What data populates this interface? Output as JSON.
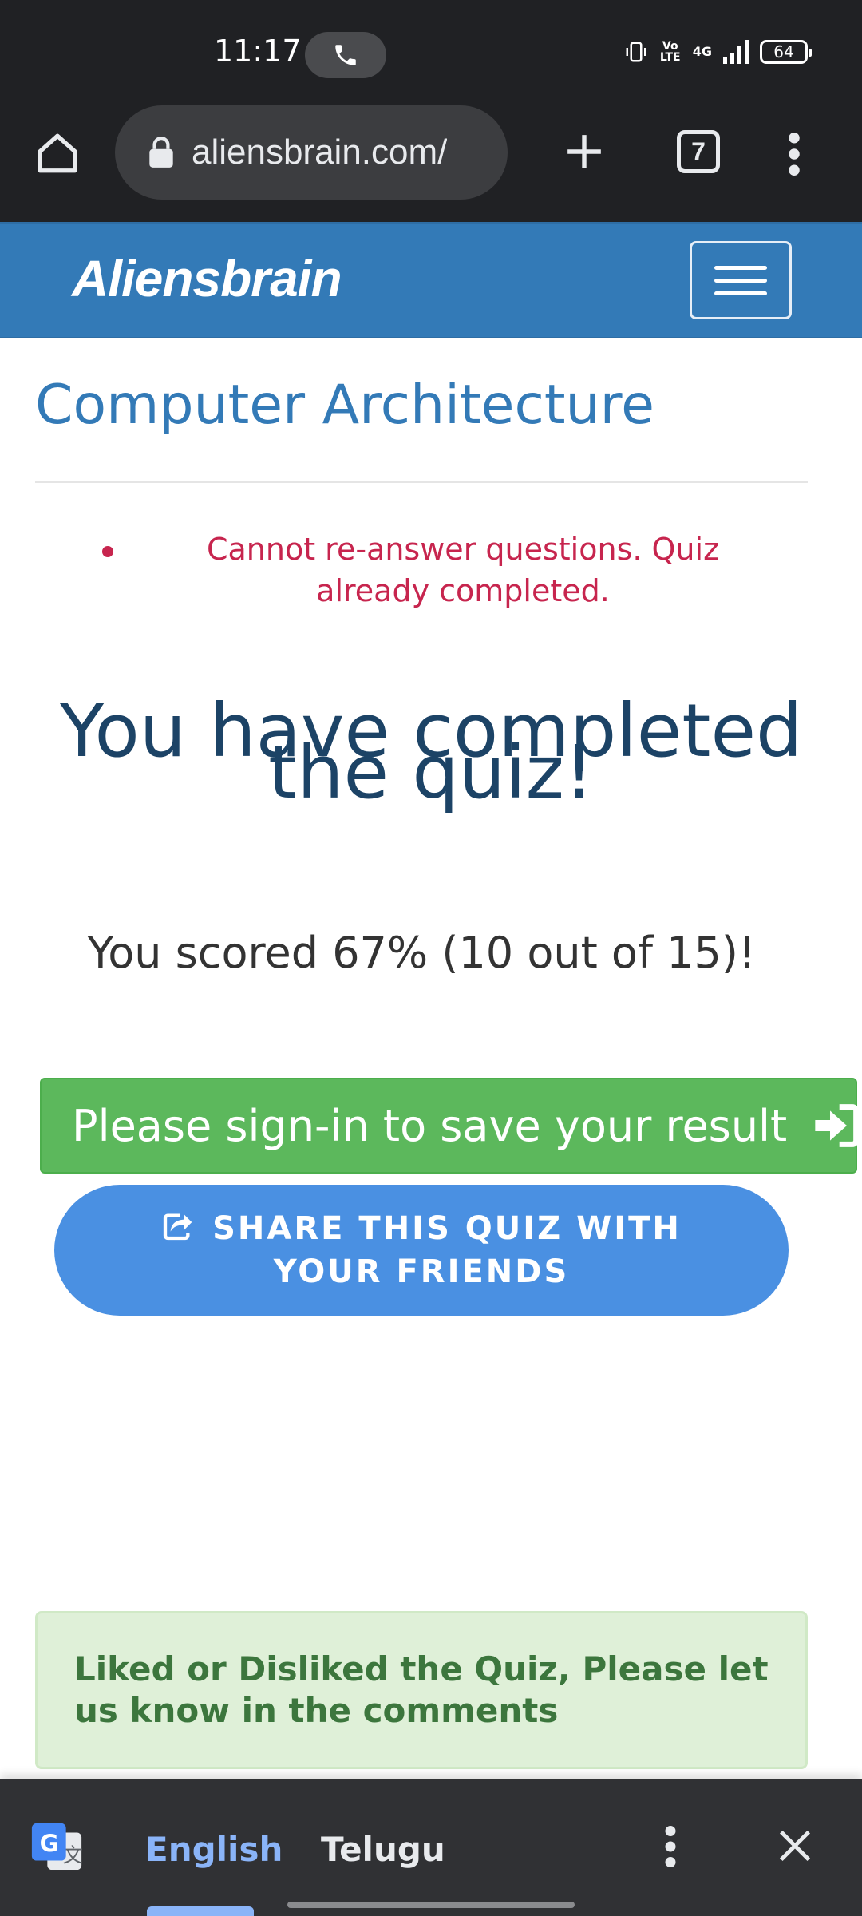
{
  "status_bar": {
    "time": "11:17",
    "network": "4G",
    "volte": "Vo LTE",
    "battery": "64"
  },
  "browser": {
    "url": "aliensbrain.com/",
    "tab_count": "7"
  },
  "navbar": {
    "brand": "Aliensbrain"
  },
  "page": {
    "title": "Computer Architecture",
    "notice": "Cannot re-answer questions. Quiz already completed.",
    "completed_heading": "You have completed the quiz!",
    "score_text": "You scored 67% (10 out of 15)!",
    "score_percent": 67,
    "score_correct": 10,
    "score_total": 15,
    "signin_label": "Please sign-in to save your result",
    "share_label": "SHARE THIS QUIZ WITH YOUR FRIENDS",
    "feedback": "Liked or Disliked the Quiz, Please let us know in the comments"
  },
  "translate_bar": {
    "active_language": "English",
    "other_language": "Telugu"
  },
  "colors": {
    "navbar": "#337ab7",
    "title": "#337ab7",
    "notice": "#c7254e",
    "heading": "#1c4366",
    "signin_button": "#5cb85c",
    "share_button": "#4a90e2",
    "feedback_bg": "#dff0d8",
    "feedback_text": "#3c763d",
    "browser_chrome": "#202124",
    "translate_active": "#8ab4f8"
  },
  "icons": {
    "call": "phone-icon",
    "home": "home-icon",
    "lock": "lock-icon",
    "new_tab": "plus-icon",
    "menu": "more-vert-icon",
    "nav_toggle": "hamburger-icon",
    "signin": "sign-in-icon",
    "share": "share-icon",
    "translate": "google-translate-icon",
    "close": "close-icon"
  }
}
